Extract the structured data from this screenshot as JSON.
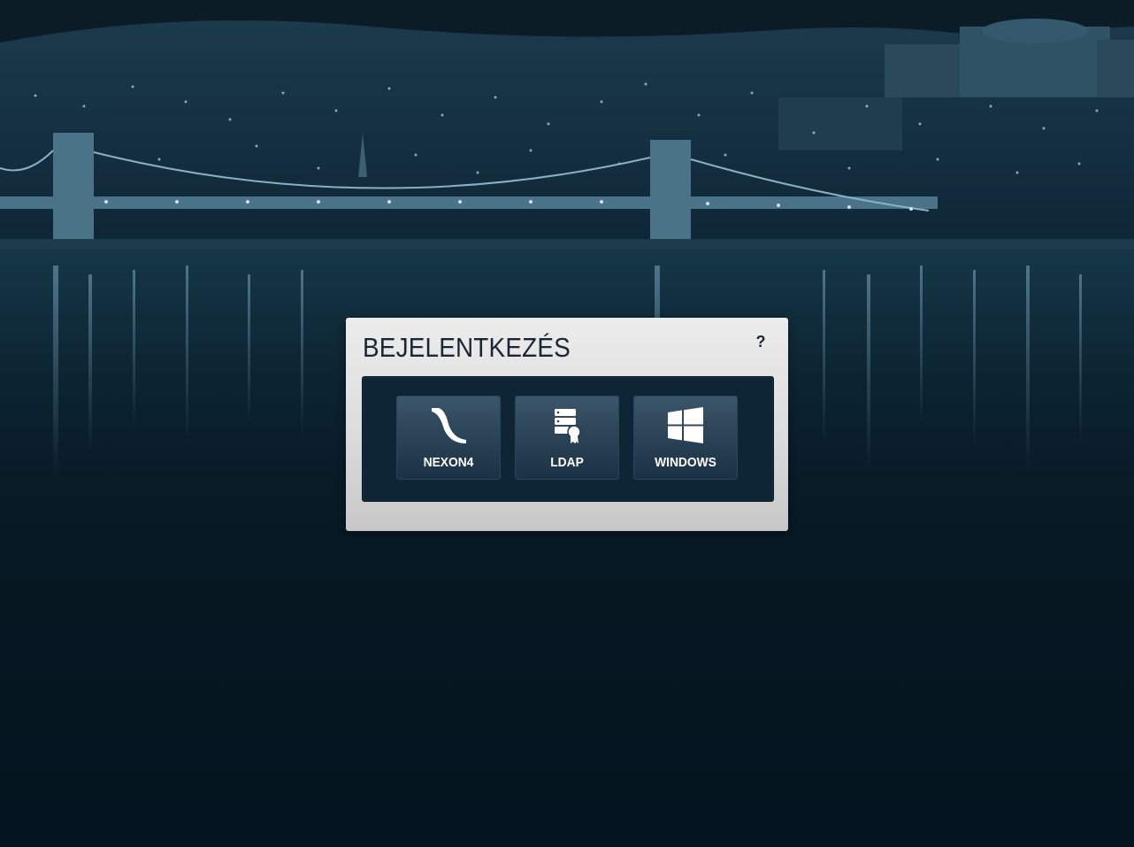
{
  "login": {
    "title": "BEJELENTKEZÉS",
    "help_label": "?",
    "providers": [
      {
        "id": "nexon4",
        "label": "NEXON4",
        "icon": "nexon-logo-icon"
      },
      {
        "id": "ldap",
        "label": "LDAP",
        "icon": "ldap-server-icon"
      },
      {
        "id": "windows",
        "label": "WINDOWS",
        "icon": "windows-logo-icon"
      }
    ]
  },
  "colors": {
    "background_dark": "#061722",
    "panel_light": "#e6e6e6",
    "provider_box": "#0e2535",
    "button_top": "#3b556a",
    "button_bottom": "#1b3244",
    "title_text": "#1a2633",
    "button_text": "#ffffff"
  }
}
